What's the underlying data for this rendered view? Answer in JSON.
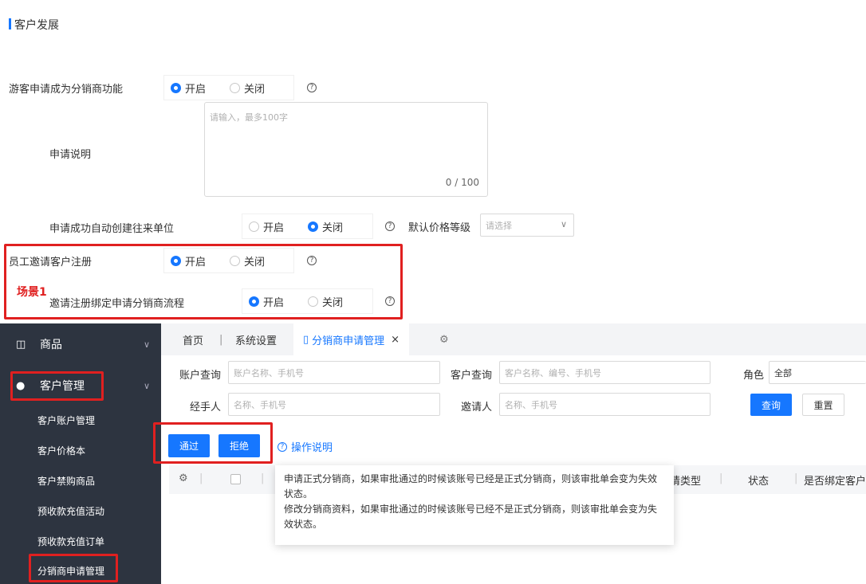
{
  "section": {
    "title": "客户发展"
  },
  "settings": {
    "guest_apply_label": "游客申请成为分销商功能",
    "opt_on": "开启",
    "opt_off": "关闭",
    "apply_note_label": "申请说明",
    "apply_note_placeholder": "请输入，最多100字",
    "apply_note_counter": "0 / 100",
    "auto_create_label": "申请成功自动创建往来单位",
    "default_price_label": "默认价格等级",
    "default_price_placeholder": "请选择",
    "staff_invite_label": "员工邀请客户注册",
    "invite_bind_label": "邀请注册绑定申请分销商流程",
    "scene_label": "场景1",
    "help_glyph": "?"
  },
  "sidebar": {
    "items": [
      {
        "label": "商品",
        "icon": "box-icon"
      },
      {
        "label": "客户管理",
        "icon": "user-group-icon"
      }
    ],
    "sub_items": [
      "客户账户管理",
      "客户价格本",
      "客户禁购商品",
      "预收款充值活动",
      "预收款充值订单",
      "分销商申请管理"
    ]
  },
  "tabs": {
    "home": "首页",
    "separator": "|",
    "settings": "系统设置",
    "active": "分销商申请管理",
    "close": "×"
  },
  "filters": {
    "account_label": "账户查询",
    "account_placeholder": "账户名称、手机号",
    "customer_label": "客户查询",
    "customer_placeholder": "客户名称、编号、手机号",
    "role_label": "角色",
    "role_value": "全部",
    "handler_label": "经手人",
    "handler_placeholder": "名称、手机号",
    "inviter_label": "邀请人",
    "inviter_placeholder": "名称、手机号",
    "query_button": "查询",
    "reset_button": "重置"
  },
  "actions": {
    "approve": "通过",
    "reject": "拒绝",
    "help_link": "操作说明"
  },
  "table": {
    "col_type_partial": "请类型",
    "col_status": "状态",
    "col_bind_partial": "是否绑定客户"
  },
  "tooltip": {
    "line1": "申请正式分销商，如果审批通过的时候该账号已经是正式分销商，则该审批单会变为失效状态。",
    "line2": "修改分销商资料，如果审批通过的时候该账号已经不是正式分销商，则该审批单会变为失效状态。"
  },
  "colors": {
    "accent": "#1677ff",
    "highlight": "#e02020",
    "sidebar_bg": "#2d3440"
  }
}
